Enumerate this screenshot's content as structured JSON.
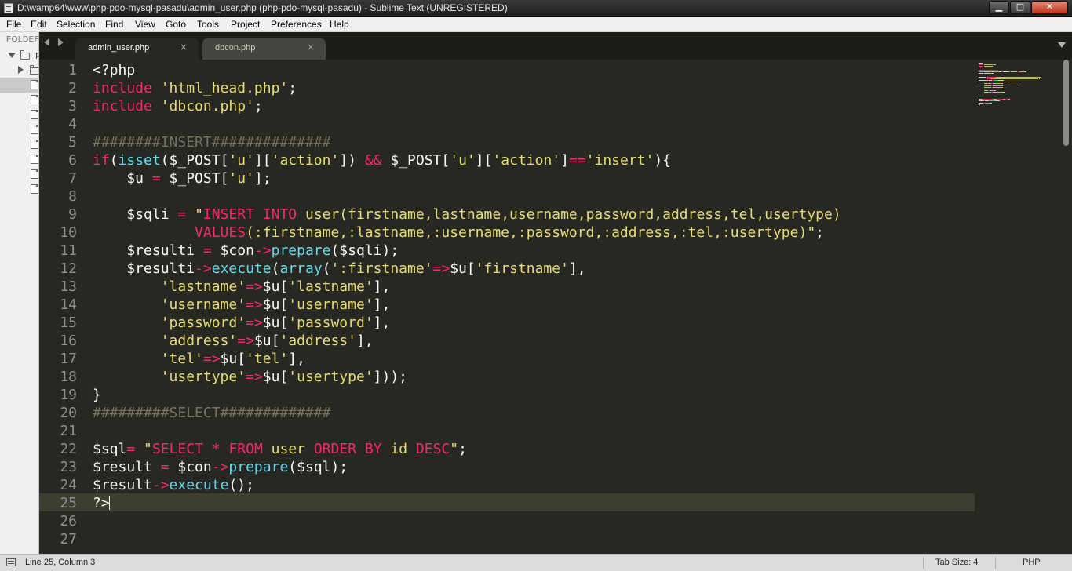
{
  "window": {
    "title": "D:\\wamp64\\www\\php-pdo-mysql-pasadu\\admin_user.php (php-pdo-mysql-pasadu) - Sublime Text (UNREGISTERED)",
    "min_glyph": "▁",
    "max_glyph": "□",
    "close_glyph": "✕"
  },
  "menu": [
    "File",
    "Edit",
    "Selection",
    "Find",
    "View",
    "Goto",
    "Tools",
    "Project",
    "Preferences",
    "Help"
  ],
  "sidebar": {
    "header": "FOLDER",
    "root_label": "p"
  },
  "tabs": [
    {
      "label": "admin_user.php",
      "active": true,
      "close": "×"
    },
    {
      "label": "dbcon.php",
      "active": false,
      "close": "×"
    }
  ],
  "gutter": [
    "1",
    "2",
    "3",
    "4",
    "5",
    "6",
    "7",
    "8",
    "9",
    "10",
    "11",
    "12",
    "13",
    "14",
    "15",
    "16",
    "17",
    "18",
    "19",
    "20",
    "21",
    "22",
    "23",
    "24",
    "25",
    "26",
    "27"
  ],
  "code": [
    [
      [
        "t",
        "<?php"
      ]
    ],
    [
      [
        "k",
        "include"
      ],
      [
        "t",
        " "
      ],
      [
        "s",
        "'html_head.php'"
      ],
      [
        "t",
        ";"
      ]
    ],
    [
      [
        "k",
        "include"
      ],
      [
        "t",
        " "
      ],
      [
        "s",
        "'dbcon.php'"
      ],
      [
        "t",
        ";"
      ]
    ],
    [],
    [
      [
        "c",
        "########INSERT##############"
      ]
    ],
    [
      [
        "k",
        "if"
      ],
      [
        "t",
        "("
      ],
      [
        "f",
        "isset"
      ],
      [
        "t",
        "($_POST["
      ],
      [
        "s",
        "'u'"
      ],
      [
        "t",
        "]["
      ],
      [
        "s",
        "'action'"
      ],
      [
        "t",
        "]) "
      ],
      [
        "k",
        "&&"
      ],
      [
        "t",
        " $_POST["
      ],
      [
        "s",
        "'u'"
      ],
      [
        "t",
        "]["
      ],
      [
        "s",
        "'action'"
      ],
      [
        "t",
        "]"
      ],
      [
        "k",
        "=="
      ],
      [
        "s",
        "'insert'"
      ],
      [
        "t",
        "){"
      ]
    ],
    [
      [
        "t",
        "    $u "
      ],
      [
        "k",
        "="
      ],
      [
        "t",
        " $_POST["
      ],
      [
        "s",
        "'u'"
      ],
      [
        "t",
        "];"
      ]
    ],
    [],
    [
      [
        "t",
        "    $sqli "
      ],
      [
        "k",
        "="
      ],
      [
        "t",
        " "
      ],
      [
        "s",
        "\""
      ],
      [
        "k",
        "INSERT INTO"
      ],
      [
        "s",
        " user(firstname,lastname,username,password,address,tel,usertype)"
      ]
    ],
    [
      [
        "s",
        "            "
      ],
      [
        "k",
        "VALUES"
      ],
      [
        "s",
        "(:firstname,:lastname,:username,:password,:address,:tel,:usertype)\""
      ],
      [
        "t",
        ";"
      ]
    ],
    [
      [
        "t",
        "    $resulti "
      ],
      [
        "k",
        "="
      ],
      [
        "t",
        " $con"
      ],
      [
        "k",
        "->"
      ],
      [
        "f",
        "prepare"
      ],
      [
        "t",
        "($sqli);"
      ]
    ],
    [
      [
        "t",
        "    $resulti"
      ],
      [
        "k",
        "->"
      ],
      [
        "f",
        "execute"
      ],
      [
        "t",
        "("
      ],
      [
        "f",
        "array"
      ],
      [
        "t",
        "("
      ],
      [
        "s",
        "':firstname'"
      ],
      [
        "k",
        "=>"
      ],
      [
        "t",
        "$u["
      ],
      [
        "s",
        "'firstname'"
      ],
      [
        "t",
        "],"
      ]
    ],
    [
      [
        "t",
        "        "
      ],
      [
        "s",
        "'lastname'"
      ],
      [
        "k",
        "=>"
      ],
      [
        "t",
        "$u["
      ],
      [
        "s",
        "'lastname'"
      ],
      [
        "t",
        "],"
      ]
    ],
    [
      [
        "t",
        "        "
      ],
      [
        "s",
        "'username'"
      ],
      [
        "k",
        "=>"
      ],
      [
        "t",
        "$u["
      ],
      [
        "s",
        "'username'"
      ],
      [
        "t",
        "],"
      ]
    ],
    [
      [
        "t",
        "        "
      ],
      [
        "s",
        "'password'"
      ],
      [
        "k",
        "=>"
      ],
      [
        "t",
        "$u["
      ],
      [
        "s",
        "'password'"
      ],
      [
        "t",
        "],"
      ]
    ],
    [
      [
        "t",
        "        "
      ],
      [
        "s",
        "'address'"
      ],
      [
        "k",
        "=>"
      ],
      [
        "t",
        "$u["
      ],
      [
        "s",
        "'address'"
      ],
      [
        "t",
        "],"
      ]
    ],
    [
      [
        "t",
        "        "
      ],
      [
        "s",
        "'tel'"
      ],
      [
        "k",
        "=>"
      ],
      [
        "t",
        "$u["
      ],
      [
        "s",
        "'tel'"
      ],
      [
        "t",
        "],"
      ]
    ],
    [
      [
        "t",
        "        "
      ],
      [
        "s",
        "'usertype'"
      ],
      [
        "k",
        "=>"
      ],
      [
        "t",
        "$u["
      ],
      [
        "s",
        "'usertype'"
      ],
      [
        "t",
        "]));"
      ]
    ],
    [
      [
        "t",
        "}"
      ]
    ],
    [
      [
        "c",
        "#########SELECT#############"
      ]
    ],
    [],
    [
      [
        "t",
        "$sql"
      ],
      [
        "k",
        "="
      ],
      [
        "t",
        " "
      ],
      [
        "s",
        "\""
      ],
      [
        "k",
        "SELECT"
      ],
      [
        "s",
        " "
      ],
      [
        "k",
        "*"
      ],
      [
        "s",
        " "
      ],
      [
        "k",
        "FROM"
      ],
      [
        "s",
        " user "
      ],
      [
        "k",
        "ORDER BY"
      ],
      [
        "s",
        " id "
      ],
      [
        "k",
        "DESC"
      ],
      [
        "s",
        "\""
      ],
      [
        "t",
        ";"
      ]
    ],
    [
      [
        "t",
        "$result "
      ],
      [
        "k",
        "="
      ],
      [
        "t",
        " $con"
      ],
      [
        "k",
        "->"
      ],
      [
        "f",
        "prepare"
      ],
      [
        "t",
        "($sql);"
      ]
    ],
    [
      [
        "t",
        "$result"
      ],
      [
        "k",
        "->"
      ],
      [
        "f",
        "execute"
      ],
      [
        "t",
        "();"
      ]
    ],
    [
      [
        "t",
        "?>"
      ]
    ],
    [],
    []
  ],
  "current_line": 25,
  "status": {
    "position": "Line 25, Column 3",
    "tab_size": "Tab Size: 4",
    "syntax": "PHP"
  },
  "colors": {
    "background": "#272822",
    "keyword": "#f92672",
    "string": "#e6db74",
    "function": "#66d9ef",
    "comment": "#75715e",
    "plain": "#f8f8f2",
    "gutter": "#90908a"
  }
}
